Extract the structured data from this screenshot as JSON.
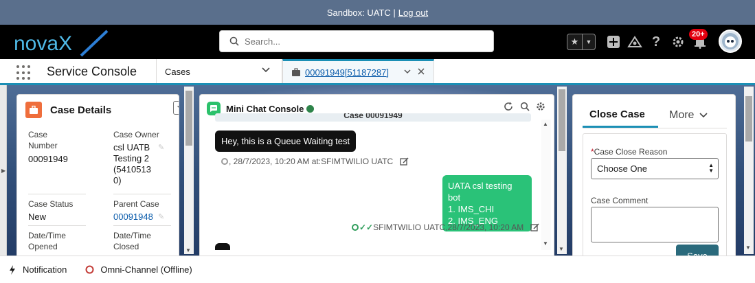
{
  "sandbox": {
    "text": "Sandbox: UATC |",
    "logout": "Log out"
  },
  "header": {
    "brand": "novaX",
    "search_placeholder": "Search...",
    "notification_count": "20+"
  },
  "nav": {
    "app_name": "Service Console",
    "object_tab": "Cases",
    "record_tab": "00091949[51187287]"
  },
  "case_details": {
    "title": "Case Details",
    "fields": {
      "case_number_label_1": "Case",
      "case_number_label_2": "Number",
      "case_number": "00091949",
      "case_owner_label": "Case Owner",
      "case_owner_lines": [
        "csl UATB",
        "Testing 2",
        "(5410513",
        "0)"
      ],
      "case_status_label": "Case Status",
      "case_status": "New",
      "parent_case_label": "Parent Case",
      "parent_case": "00091948",
      "opened_label_1": "Date/Time",
      "opened_label_2": "Opened",
      "closed_label_1": "Date/Time",
      "closed_label_2": "Closed"
    }
  },
  "chat": {
    "title": "Mini Chat Console",
    "strip_text": "Case 00091949",
    "messages": [
      {
        "direction": "in",
        "text": "Hey, this is a Queue Waiting test",
        "meta": ", 28/7/2023, 10:20 AM at:SFIMTWILIO UATC"
      },
      {
        "direction": "out",
        "lines": [
          "UATA csl testing bot",
          "1. IMS_CHI",
          "2. IMS_ENG"
        ],
        "meta": "SFIMTWILIO UATC,28/7/2023, 10:20 AM"
      }
    ]
  },
  "close_case": {
    "tab_active": "Close Case",
    "tab_more": "More",
    "reason_label": "Case Close Reason",
    "reason_required": "*",
    "reason_value": "Choose One",
    "comment_label": "Case Comment",
    "save_label": "Save"
  },
  "footer": {
    "notification": "Notification",
    "omni": "Omni-Channel (Offline)"
  },
  "colors": {
    "accent": "#1b8fb5",
    "chat_green": "#2ac278",
    "case_orange": "#ef6e3c",
    "save_teal": "#2a6a7c"
  }
}
